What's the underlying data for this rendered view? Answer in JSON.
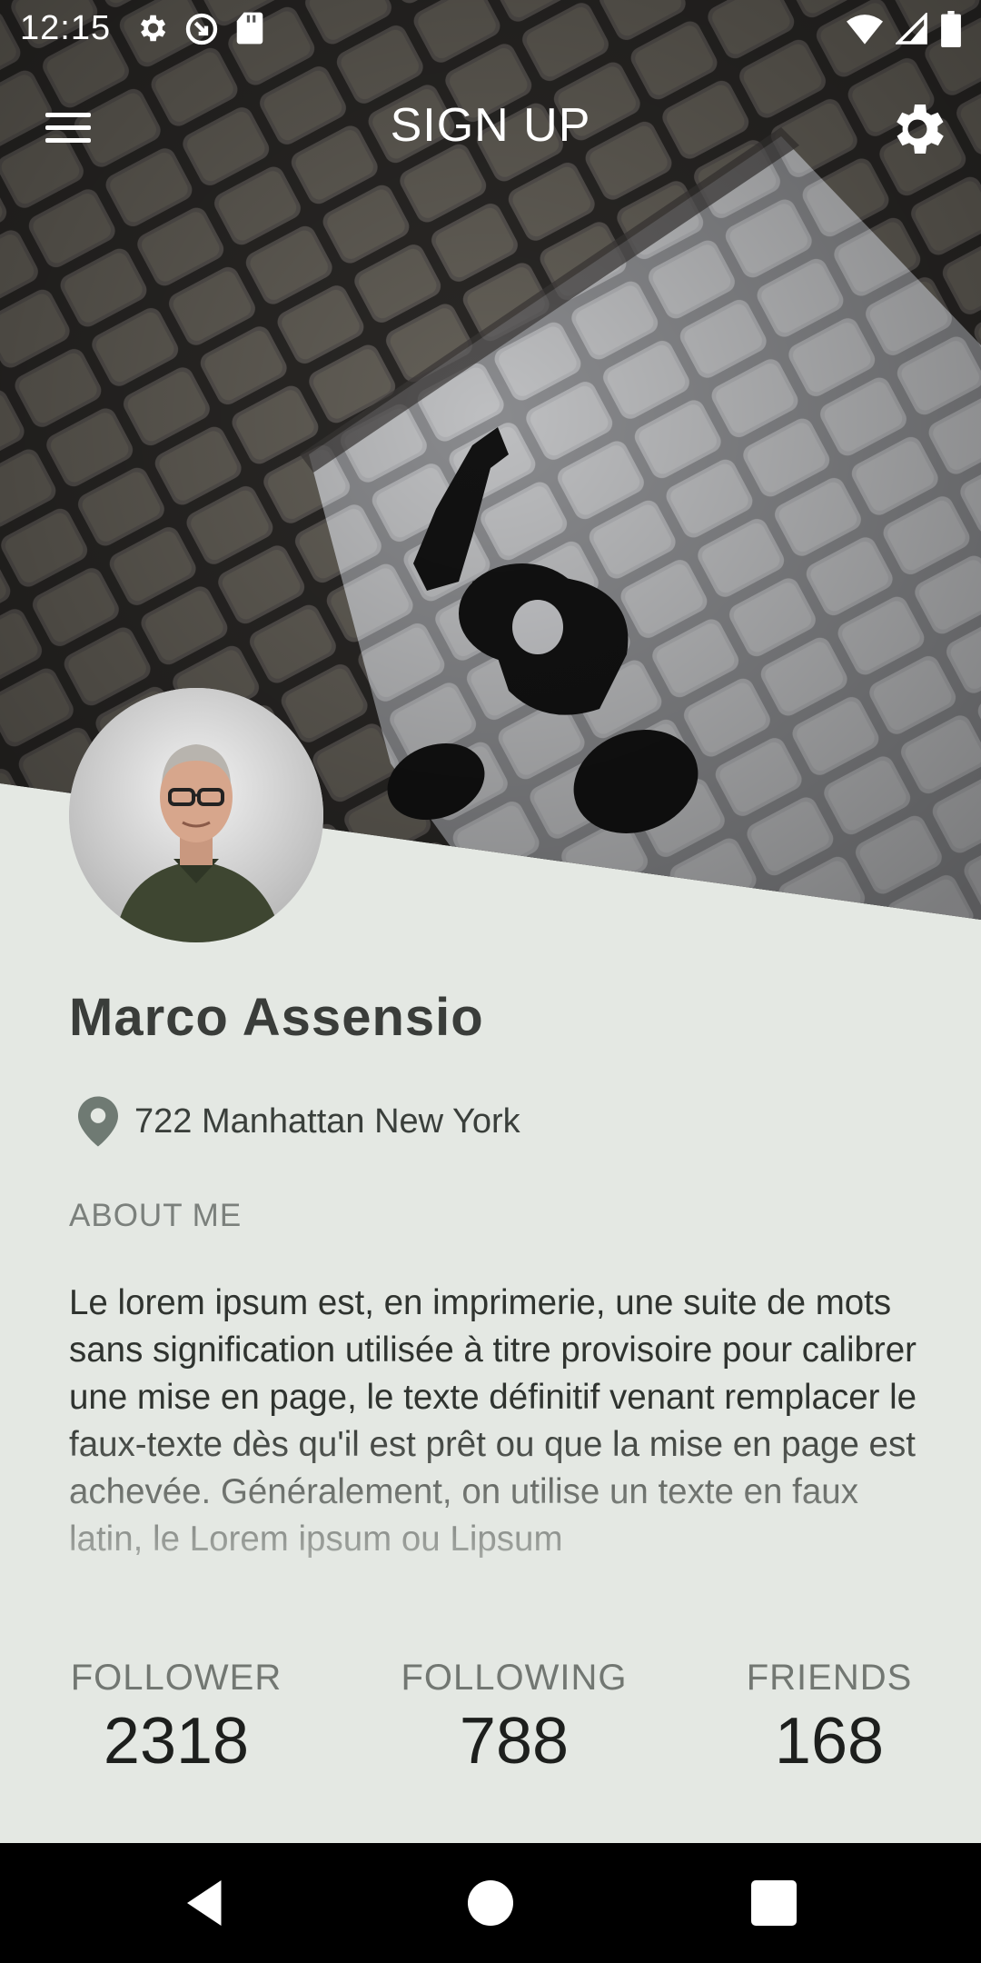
{
  "status_bar": {
    "time": "12:15",
    "icons": [
      "gear-icon",
      "sync-icon",
      "sd-card-icon",
      "wifi-icon",
      "signal-icon",
      "battery-icon"
    ]
  },
  "app_bar": {
    "title": "SIGN UP",
    "menu_icon": "hamburger-menu-icon",
    "settings_icon": "gear-icon"
  },
  "profile": {
    "name": "Marco Assensio",
    "location": "722 Manhattan New York",
    "about_label": "ABOUT ME",
    "about_text": "Le lorem ipsum est, en imprimerie, une suite de mots sans signification utilisée à titre provisoire pour calibrer une mise en page, le texte définitif venant remplacer le faux-texte dès qu'il est prêt ou que la mise en page est achevée. Généralement, on utilise un texte en faux latin, le Lorem ipsum ou Lipsum"
  },
  "stats": [
    {
      "label": "FOLLOWER",
      "value": "2318"
    },
    {
      "label": "FOLLOWING",
      "value": "788"
    },
    {
      "label": "FRIENDS",
      "value": "168"
    }
  ],
  "nav_bar": {
    "back_icon": "back-triangle-icon",
    "home_icon": "home-circle-icon",
    "recents_icon": "recents-square-icon"
  },
  "colors": {
    "background": "#e4e8e3",
    "title_text": "#3a3d3a",
    "muted_text": "#7b807c",
    "pin_icon": "#6f7a73"
  }
}
